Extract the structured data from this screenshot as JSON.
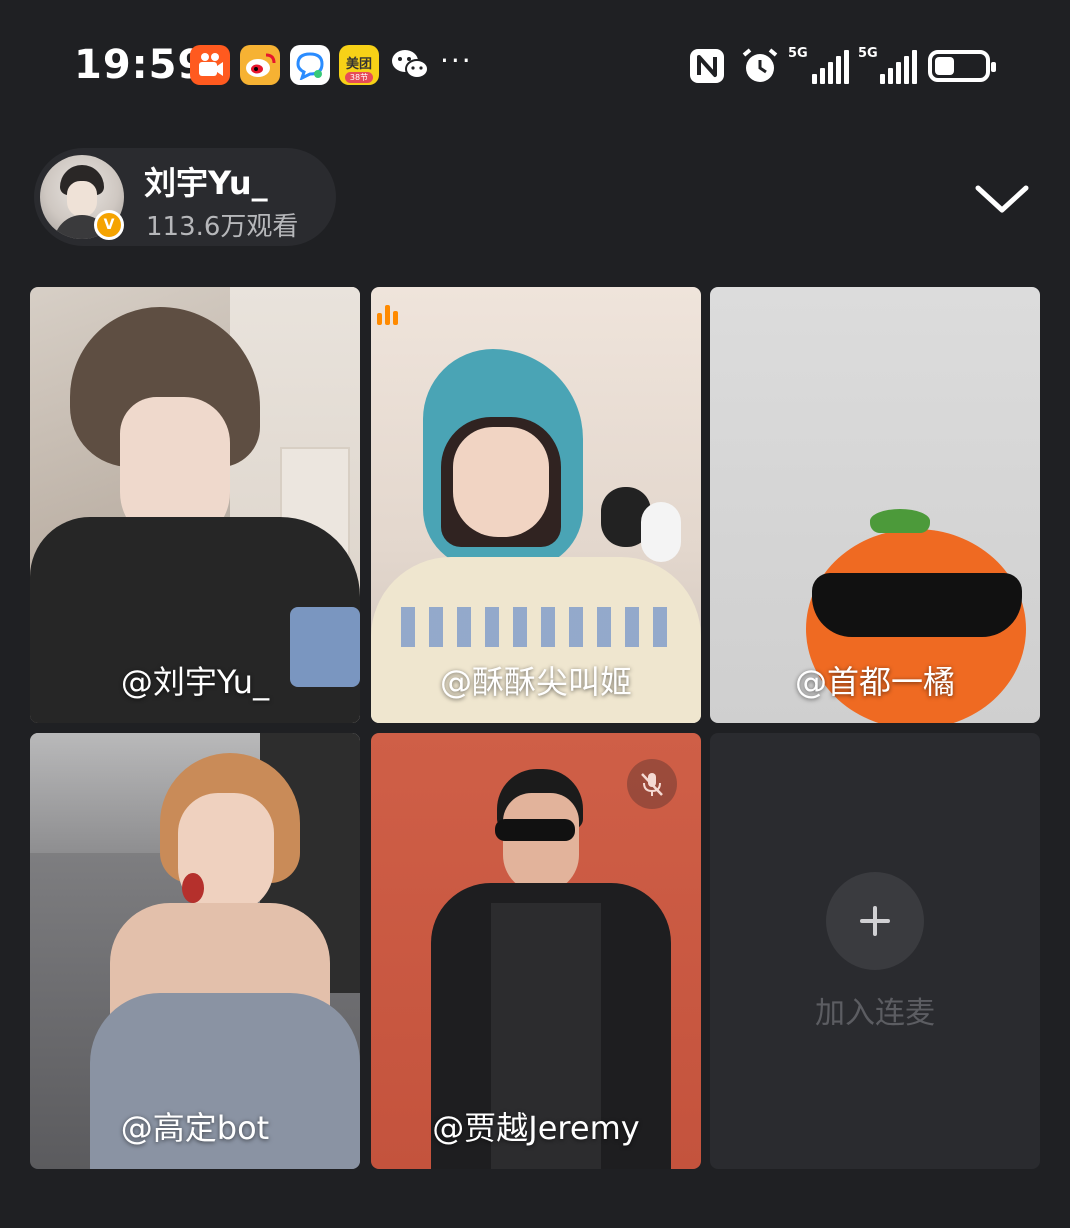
{
  "status_bar": {
    "time": "19:59",
    "app_icons": [
      "kuaishou-icon",
      "weibo-icon",
      "chat-bubble-icon",
      "meituan-icon",
      "wechat-icon"
    ],
    "meituan_text": "美团",
    "meituan_tag": "38节",
    "more": "···",
    "network_1": "5G",
    "network_2": "5G",
    "battery_level": 0.4
  },
  "host": {
    "name": "刘宇Yu_",
    "viewers": "113.6万观看"
  },
  "participants": [
    {
      "label": "@刘宇Yu_",
      "speaking": false,
      "muted": false
    },
    {
      "label": "@酥酥尖叫姬",
      "speaking": true,
      "muted": false
    },
    {
      "label": "@首都一橘",
      "speaking": false,
      "muted": false
    },
    {
      "label": "@高定bot",
      "speaking": false,
      "muted": false
    },
    {
      "label": "@贾越Jeremy",
      "speaking": false,
      "muted": true
    }
  ],
  "join": {
    "label": "加入连麦"
  },
  "colors": {
    "background": "#1f2023",
    "speaking_accent": "#ff8a00",
    "verified_badge": "#f5a300"
  }
}
